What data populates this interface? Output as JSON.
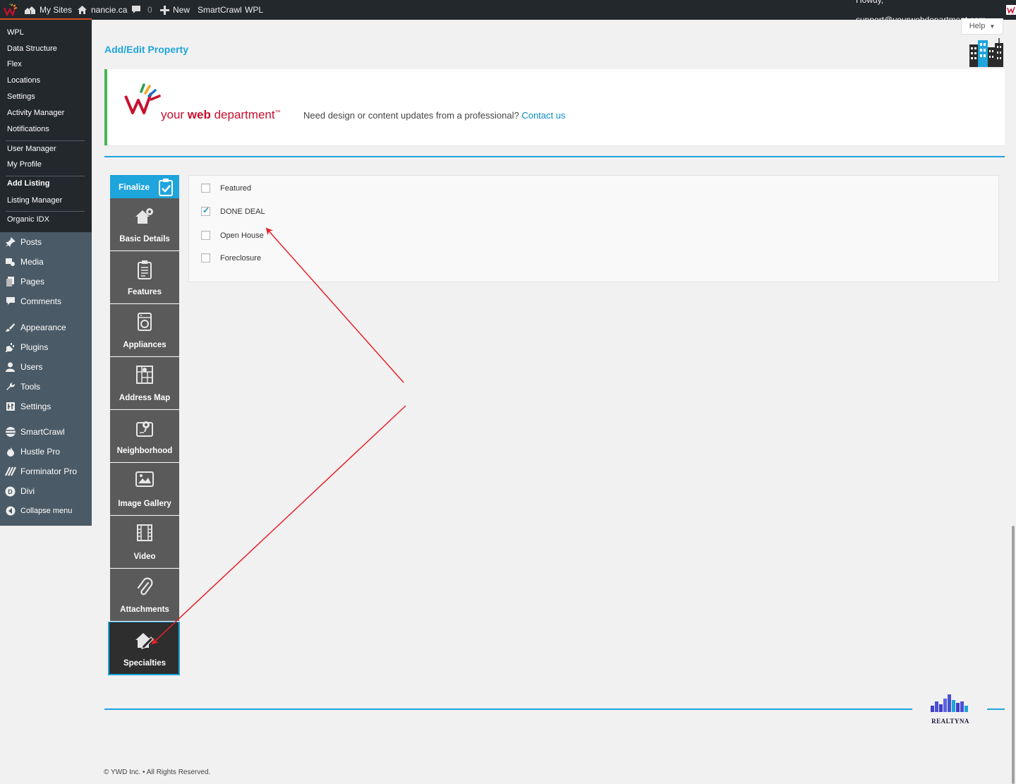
{
  "adminbar": {
    "my_sites": "My Sites",
    "site_name": "nancie.ca",
    "comments_count": "0",
    "new_label": "New",
    "smartcrawl": "SmartCrawl",
    "wpl": "WPL",
    "howdy": "Howdy, support@yourwebdepartment.com"
  },
  "sidebar": {
    "submenu": [
      "WPL",
      "Data Structure",
      "Flex",
      "Locations",
      "Settings",
      "Activity Manager",
      "Notifications",
      "User Manager",
      "My Profile",
      "Add Listing",
      "Listing Manager",
      "Organic IDX"
    ],
    "menu": [
      "Posts",
      "Media",
      "Pages",
      "Comments",
      "Appearance",
      "Plugins",
      "Users",
      "Tools",
      "Settings",
      "SmartCrawl",
      "Hustle Pro",
      "Forminator Pro",
      "Divi",
      "Collapse menu"
    ]
  },
  "header": {
    "help_label": "Help",
    "page_title": "Add/Edit Property"
  },
  "banner": {
    "logo_prefix": "your ",
    "logo_bold": "web",
    "logo_suffix": " department",
    "logo_tm": "™",
    "message": "Need design or content updates from a professional?",
    "link_text": "Contact us",
    "accent_green": "#46b450"
  },
  "tabs": {
    "finalize": "Finalize",
    "items": [
      "Basic Details",
      "Features",
      "Appliances",
      "Address Map",
      "Neighborhood",
      "Image Gallery",
      "Video",
      "Attachments",
      "Specialties"
    ],
    "active": "Specialties"
  },
  "specialties": [
    {
      "label": "Featured",
      "checked": false
    },
    {
      "label": "DONE DEAL",
      "checked": true
    },
    {
      "label": "Open House",
      "checked": false
    },
    {
      "label": "Foreclosure",
      "checked": false
    }
  ],
  "footer": {
    "brand": "REALTYNA",
    "copyright": "© YWD Inc. • All Rights Reserved."
  },
  "colors": {
    "accent_blue": "#1ea5dc",
    "annotation_red": "#e8202a"
  }
}
